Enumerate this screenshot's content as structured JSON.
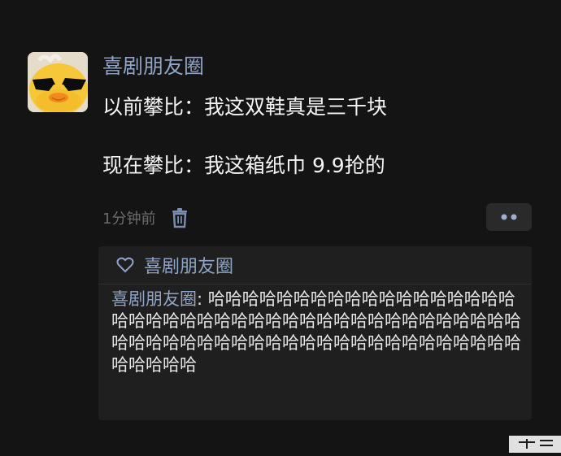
{
  "post": {
    "author_name": "喜剧朋友圈",
    "avatar_icon": "duck-with-sunglasses-avatar",
    "content_lines": [
      "以前攀比：我这双鞋真是三千块",
      "",
      "现在攀比：我这箱纸巾 9.9抢的"
    ],
    "time": "1分钟前",
    "delete_icon": "trash-icon",
    "more_icon": "more-dots-icon"
  },
  "interaction": {
    "like_icon": "heart-outline-icon",
    "likes": "喜剧朋友圈",
    "comment": {
      "commenter": "喜剧朋友圈",
      "separator": ": ",
      "text": "哈哈哈哈哈哈哈哈哈哈哈哈哈哈哈哈哈哈哈哈哈哈哈哈哈哈哈哈哈哈哈哈哈哈哈哈哈哈哈哈哈哈哈哈哈哈哈哈哈哈哈哈哈哈哈哈哈哈哈哈哈哈哈哈哈哈哈哈哈哈哈"
    }
  },
  "colors": {
    "background": "#141414",
    "name_link": "#8fa4c6",
    "body_text": "#f4f4f4",
    "time_text": "#6c6c6c",
    "panel": "#1f1f1f"
  }
}
